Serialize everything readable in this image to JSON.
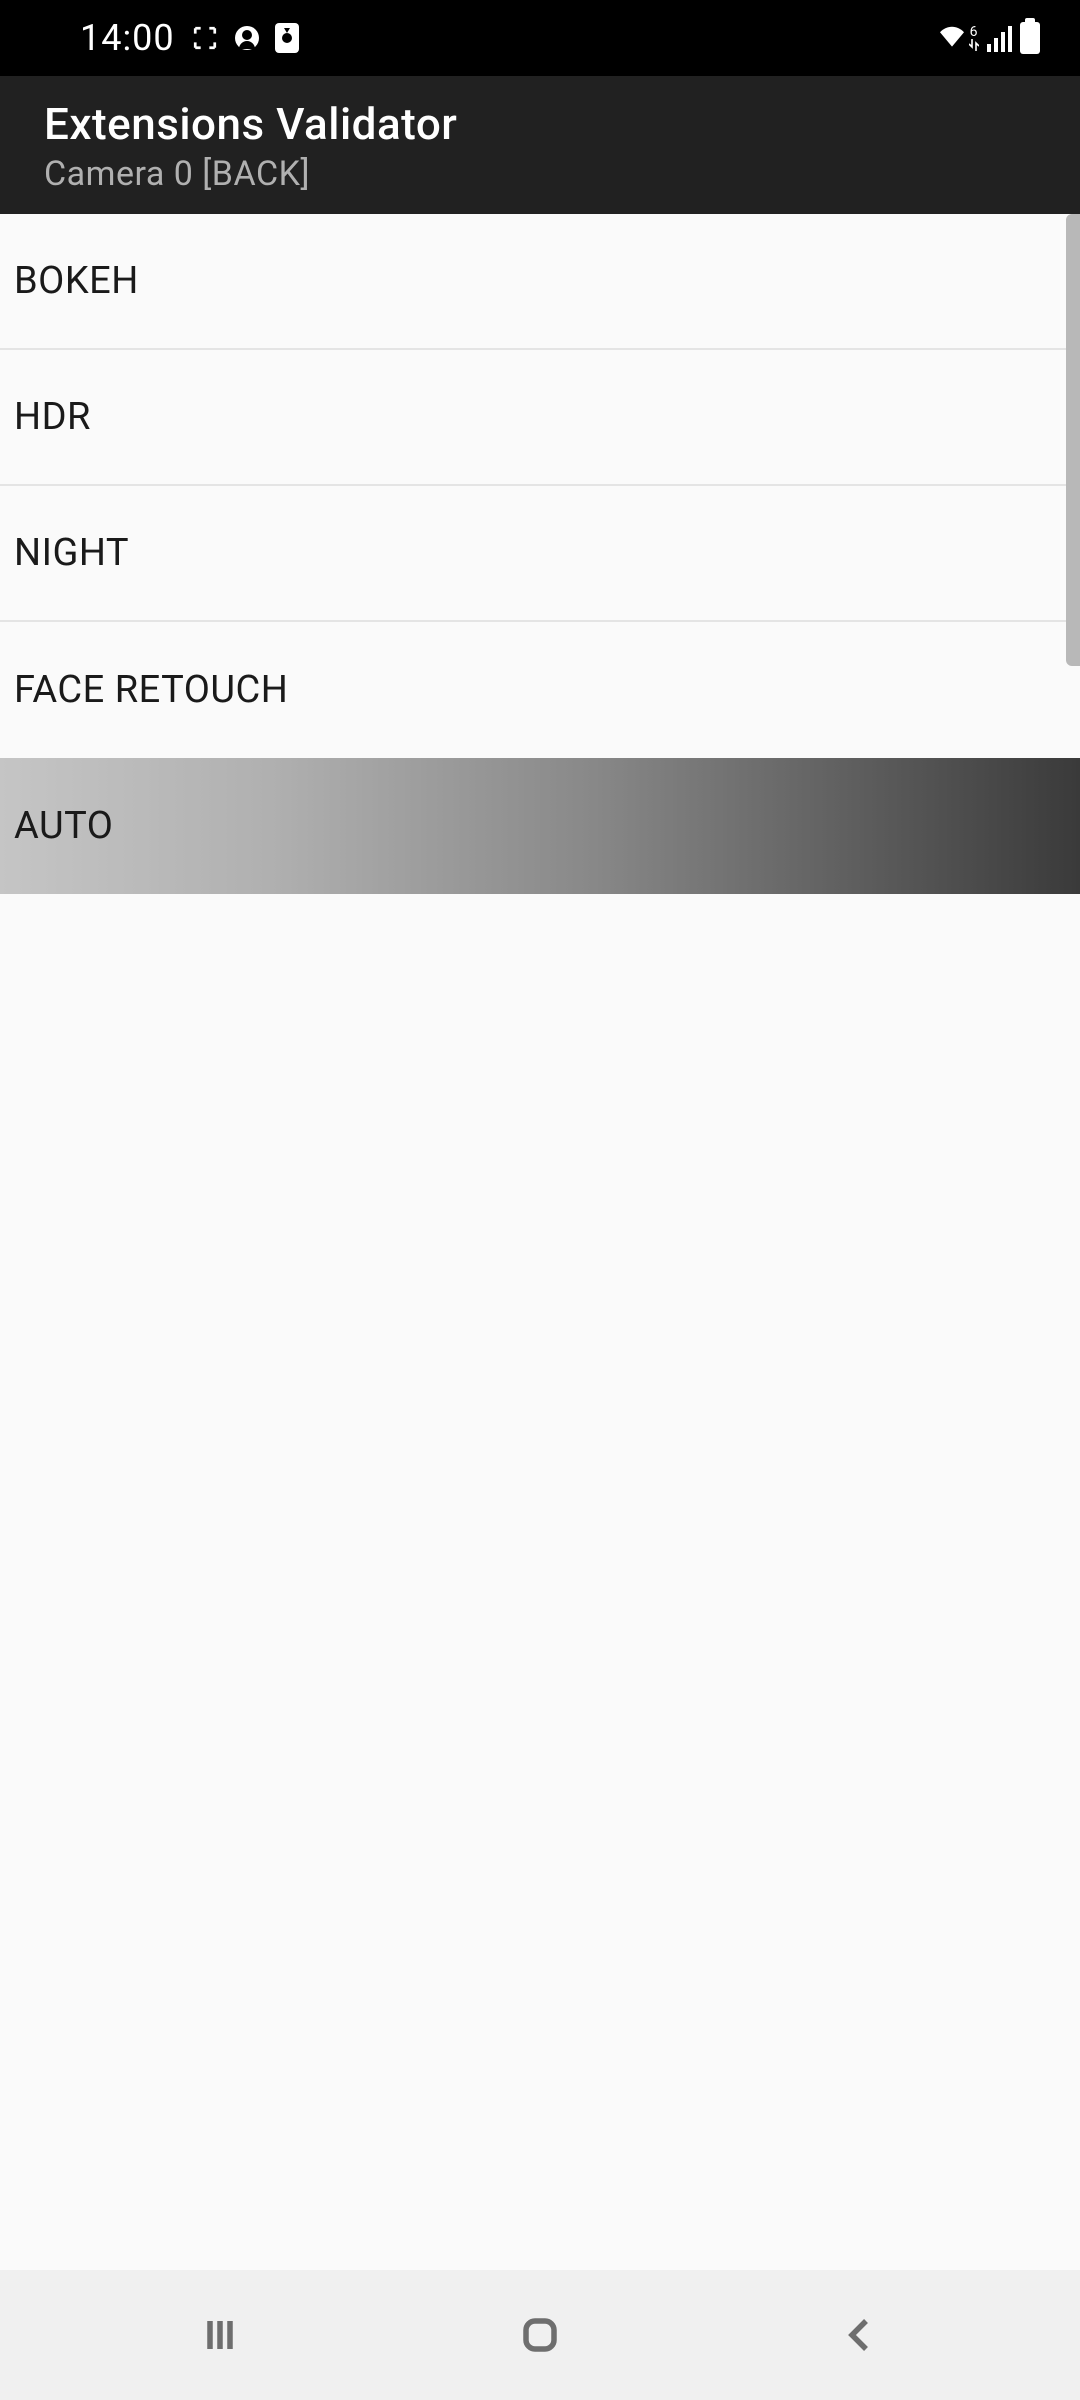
{
  "status": {
    "time": "14:00"
  },
  "appbar": {
    "title": "Extensions Validator",
    "subtitle": "Camera 0 [BACK]"
  },
  "list": [
    {
      "label": "BOKEH",
      "active": false
    },
    {
      "label": "HDR",
      "active": false
    },
    {
      "label": "NIGHT",
      "active": false
    },
    {
      "label": "FACE RETOUCH",
      "active": false
    },
    {
      "label": "AUTO",
      "active": true
    }
  ]
}
